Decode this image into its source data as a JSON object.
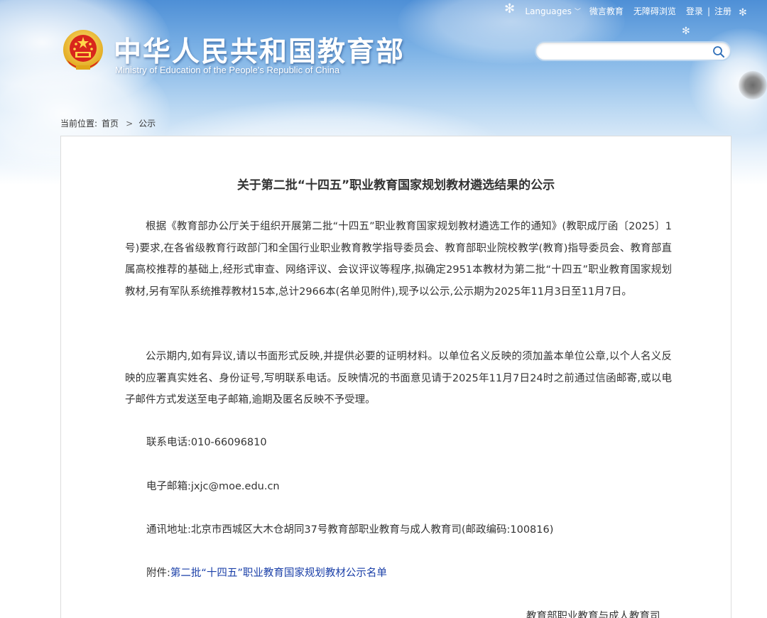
{
  "header": {
    "site_title_cn": "中华人民共和国教育部",
    "site_title_en": "Ministry of Education of the People's Republic of China",
    "top_links": {
      "languages": "Languages",
      "weibo": "微言教育",
      "accessibility": "无障碍浏览",
      "login": "登录",
      "separator": "|",
      "register": "注册"
    },
    "search_placeholder": ""
  },
  "breadcrumb": {
    "label": "当前位置:",
    "home": "首页",
    "separator": ">",
    "current": "公示"
  },
  "article": {
    "title": "关于第二批“十四五”职业教育国家规划教材遴选结果的公示",
    "paragraph1": "根据《教育部办公厅关于组织开展第二批“十四五”职业教育国家规划教材遴选工作的通知》(教职成厅函〔2025〕1号)要求,在各省级教育行政部门和全国行业职业教育教学指导委员会、教育部职业院校教学(教育)指导委员会、教育部直属高校推荐的基础上,经形式审查、网络评议、会议评议等程序,拟确定2951本教材为第二批“十四五”职业教育国家规划教材,另有军队系统推荐教材15本,总计2966本(名单见附件),现予以公示,公示期为2025年11月3日至11月7日。",
    "paragraph2": "公示期内,如有异议,请以书面形式反映,并提供必要的证明材料。以单位名义反映的须加盖本单位公章,以个人名义反映的应署真实姓名、身份证号,写明联系电话。反映情况的书面意见请于2025年11月7日24时之前通过信函邮寄,或以电子邮件方式发送至电子邮箱,逾期及匿名反映不予受理。",
    "phone_line": "联系电话:010-66096810",
    "email_line": "电子邮箱:jxjc@moe.edu.cn",
    "address_line": "通讯地址:北京市西城区大木仓胡同37号教育部职业教育与成人教育司(邮政编码:100816)",
    "attachment_label": "附件:",
    "attachment_link": "第二批“十四五”职业教育国家规划教材公示名单",
    "signature": "教育部职业教育与成人教育司"
  },
  "colors": {
    "link": "#1a3fa8",
    "text": "#333333",
    "sky_top": "#4e8fd6"
  }
}
